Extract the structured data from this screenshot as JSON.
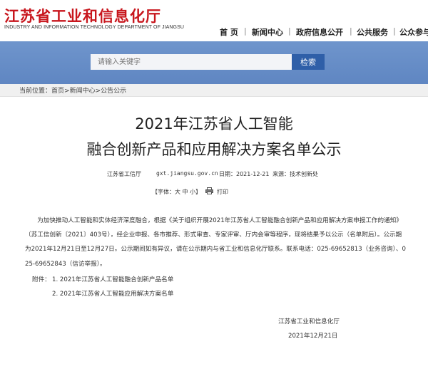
{
  "header": {
    "site_title": "江苏省工业和信息化厅",
    "site_subtitle": "INDUSTRY AND INFORMATION TECHNOLOGY DEPARTMENT OF JIANGSU",
    "nav": [
      "首 页",
      "新闻中心",
      "政府信息公开",
      "公共服务",
      "公众参与"
    ]
  },
  "search": {
    "placeholder": "请输入关键字",
    "button": "检索"
  },
  "breadcrumb": {
    "prefix": "当前位置：",
    "home": "首页",
    "sep1": ">",
    "news": "新闻中心",
    "sep2": ">",
    "notice": "公告公示"
  },
  "article": {
    "title_line1": "2021年江苏省人工智能",
    "title_line2": "融合创新产品和应用解决方案名单公示",
    "source": "江苏省工信厅",
    "site": "gxt.jiangsu.gov.cn",
    "date": "日期：2021-12-21",
    "origin": "来源：技术创新处",
    "font_label": "【字体：",
    "font_large": "大",
    "font_medium": "中",
    "font_small": "小",
    "font_close": "】",
    "print": "打印",
    "body": "为加快推动人工智能和实体经济深度融合，根据《关于组织开展2021年江苏省人工智能融合创新产品和应用解决方案申报工作的通知》（苏工信创新〔2021〕403号），经企业申报、各市推荐、形式审查、专家评审、厅内会审等程序，现将结果予以公示（名单附后）。公示期为2021年12月21日至12月27日。公示期间如有异议，请在公示期内与省工业和信息化厅联系。联系电话：025-69652813（业务咨询）、025-69652843（信访举报）。",
    "attachments_label": "附件：",
    "attachment_1": "1. 2021年江苏省人工智能融合创新产品名单",
    "attachment_2": "2. 2021年江苏省人工智能应用解决方案名单",
    "signature_org": "江苏省工业和信息化厅",
    "signature_date": "2021年12月21日"
  },
  "colors": {
    "brand_red": "#c8161d",
    "search_band": "#6b8fc7",
    "search_button": "#2f5fa8"
  },
  "icons": {
    "print": "printer-icon"
  }
}
